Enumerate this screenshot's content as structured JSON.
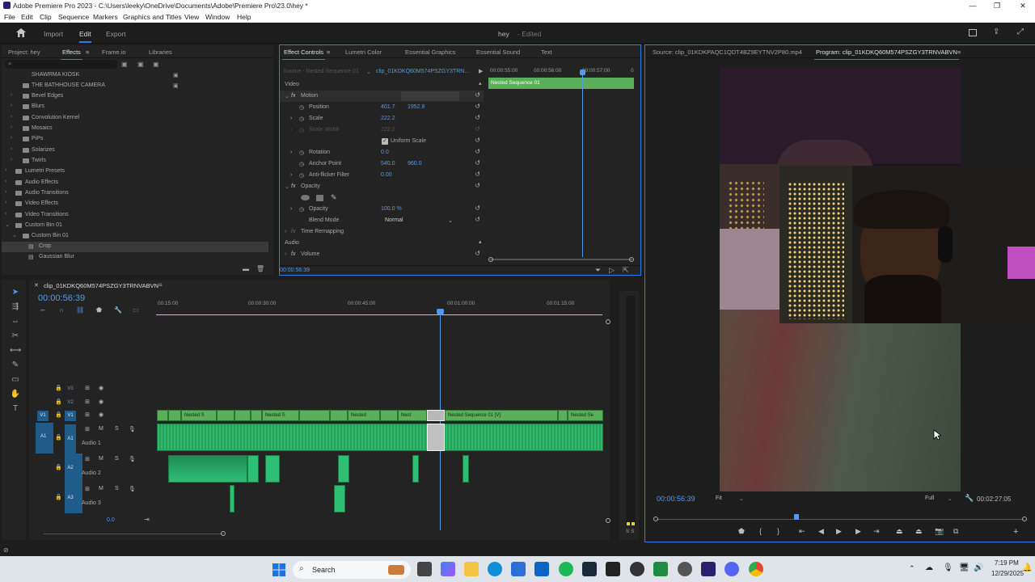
{
  "window": {
    "title": "Adobe Premiere Pro 2023 - C:\\Users\\leeky\\OneDrive\\Documents\\Adobe\\Premiere Pro\\23.0\\hey *",
    "controls": {
      "minimize": "—",
      "maximize": "❐",
      "close": "✕"
    }
  },
  "menu": [
    "File",
    "Edit",
    "Clip",
    "Sequence",
    "Markers",
    "Graphics and Titles",
    "View",
    "Window",
    "Help"
  ],
  "workspace": {
    "tabs": [
      "Import",
      "Edit",
      "Export"
    ],
    "active": "Edit",
    "project_name": "hey",
    "project_status": "- Edited"
  },
  "effects_panel": {
    "tabs": [
      "Project: hey",
      "Effects",
      "Frame.io",
      "Libraries"
    ],
    "active_tab": "Effects",
    "tree": [
      {
        "label": "SHAWRMA KIOSK"
      },
      {
        "label": "THE BATHHOUSE CAMERA"
      },
      {
        "label": "Bevel Edges"
      },
      {
        "label": "Blurs"
      },
      {
        "label": "Convolution Kernel"
      },
      {
        "label": "Mosaics"
      },
      {
        "label": "PiPs"
      },
      {
        "label": "Solarizes"
      },
      {
        "label": "Twirls"
      },
      {
        "label": "Lumetri Presets"
      },
      {
        "label": "Audio Effects"
      },
      {
        "label": "Audio Transitions"
      },
      {
        "label": "Video Effects"
      },
      {
        "label": "Video Transitions"
      },
      {
        "label": "Custom Bin 01"
      },
      {
        "label": "Custom Bin 01"
      },
      {
        "label": "Crop"
      },
      {
        "label": "Gaussian Blur"
      }
    ]
  },
  "effect_controls": {
    "tabs": [
      "Effect Controls",
      "Lumetri Color",
      "Essential Graphics",
      "Essential Sound",
      "Text"
    ],
    "active_tab": "Effect Controls",
    "source_label": "Source - Nested Sequence 01",
    "clip_label": "clip_01KDKQ60M574PSZGY3TRN...",
    "mini_timeline": {
      "times": [
        "00:00:55:00",
        "00:00:56:00",
        "00:00:57:00",
        "0"
      ],
      "clip": "Nested Sequence 01"
    },
    "section_video": "Video",
    "section_audio": "Audio",
    "motion": "Motion",
    "position": {
      "label": "Position",
      "x": "401.7",
      "y": "1952.8"
    },
    "scale": {
      "label": "Scale",
      "value": "222.2"
    },
    "scale_width": {
      "label": "Scale Width",
      "value": "222.2"
    },
    "uniform_scale": "Uniform Scale",
    "rotation": {
      "label": "Rotation",
      "value": "0.0"
    },
    "anchor": {
      "label": "Anchor Point",
      "x": "540.0",
      "y": "960.0"
    },
    "antiflicker": {
      "label": "Anti-flicker Filter",
      "value": "0.00"
    },
    "opacity_group": "Opacity",
    "opacity": {
      "label": "Opacity",
      "value": "100.0 %"
    },
    "blend": {
      "label": "Blend Mode",
      "value": "Normal"
    },
    "time_remap": "Time Remapping",
    "volume": "Volume",
    "timecode": "00:00:56:39"
  },
  "monitor": {
    "source_tab": "Source: clip_01KDKPAQC1QDT4BZ9EYTNV2P80.mp4",
    "program_tab": "Program: clip_01KDKQ60M574PSZGY3TRNVABVN",
    "timecode": "00:00:56:39",
    "fit": "Fit",
    "quality": "Full",
    "duration": "00:02:27:05",
    "playhead_fraction": 0.38
  },
  "timeline": {
    "sequence_name": "clip_01KDKQ60M574PSZGY3TRNVABVN",
    "timecode": "00:00:56:39",
    "ruler": [
      "00:15:00",
      "00:00:30:00",
      "00:00:45:00",
      "00:01:00:00",
      "00:01:15:00"
    ],
    "tracks": {
      "v3": "V3",
      "v2": "V2",
      "v1": "V1",
      "a1": "A1",
      "a2": "A2",
      "a3": "A3",
      "audio1": "Audio 1",
      "audio2": "Audio 2",
      "audio3": "Audio 3",
      "m": "M",
      "s": "S",
      "master_value": "0.0"
    },
    "video_clips": [
      "Nested S",
      "Nested S",
      "Nested",
      "Nest",
      "Nested Sequence 01 [V]",
      "Nested Se"
    ],
    "meter_label": "S S"
  },
  "taskbar": {
    "search": "Search",
    "time": "7:19 PM",
    "date": "12/29/2025"
  }
}
